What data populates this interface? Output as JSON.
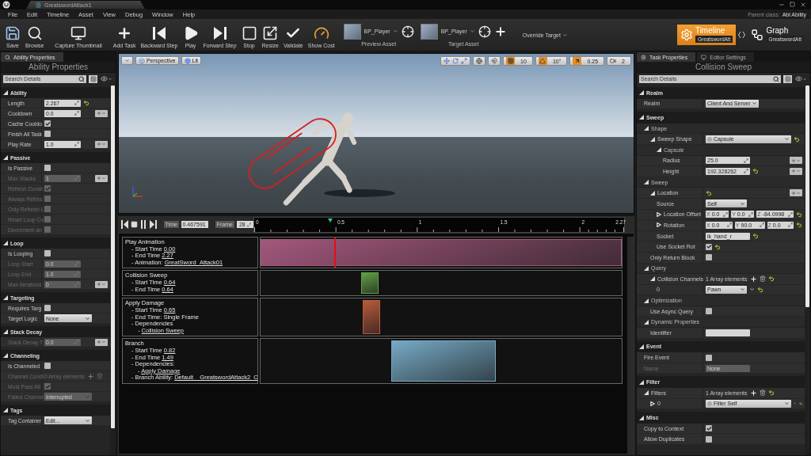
{
  "title_bar": {
    "tab": "GreatswordAttack1"
  },
  "menu": [
    "File",
    "Edit",
    "Timeline",
    "Asset",
    "View",
    "Debug",
    "Window",
    "Help"
  ],
  "parent_class": {
    "label": "Parent class:",
    "value": "Abl Ability"
  },
  "toolbar": {
    "buttons": [
      {
        "kind": "save",
        "label": "Save"
      },
      {
        "kind": "browse",
        "label": "Browse"
      },
      {
        "kind": "capture",
        "label": "Capture Thumbnail"
      },
      {
        "kind": "add",
        "label": "Add Task"
      },
      {
        "kind": "back",
        "label": "Backward Step"
      },
      {
        "kind": "play",
        "label": "Play"
      },
      {
        "kind": "forward",
        "label": "Forward Step"
      },
      {
        "kind": "stop",
        "label": "Stop"
      },
      {
        "kind": "resize",
        "label": "Resize"
      },
      {
        "kind": "validate",
        "label": "Validate"
      },
      {
        "kind": "cost",
        "label": "Show Cost"
      }
    ],
    "assets": [
      {
        "value": "BP_Player",
        "caption": "Preview Asset"
      },
      {
        "value": "BP_Player",
        "caption": "Target Asset"
      }
    ],
    "override": "Override Target",
    "modes": [
      {
        "label": "Timeline",
        "asset": "GreatswordAtt",
        "selected": true
      },
      {
        "label": "Graph",
        "asset": "GreatswordAtt",
        "selected": false
      }
    ]
  },
  "left_panel": {
    "tabs": [
      {
        "label": "Ability Properties",
        "selected": true
      }
    ],
    "title": "Ability Properties",
    "search": {
      "placeholder": "Search Details"
    },
    "categories": [
      {
        "kind": "category",
        "label": "Ability",
        "children": [
          {
            "kind": "number",
            "label": "Length",
            "value": "2.267",
            "reset": true
          },
          {
            "kind": "number",
            "label": "Cooldown",
            "value": "0.0",
            "spin": true
          },
          {
            "kind": "check",
            "label": "Cache Cooldo",
            "checked": true
          },
          {
            "kind": "check",
            "label": "Finish All Task",
            "checked": false
          },
          {
            "kind": "number",
            "label": "Play Rate",
            "value": "1.0",
            "spin": true
          }
        ]
      },
      {
        "kind": "category",
        "label": "Passive",
        "children": [
          {
            "kind": "check",
            "label": "Is Passive",
            "checked": false,
            "disabled": false
          },
          {
            "kind": "number",
            "label": "Max Stacks",
            "value": "1",
            "spin": true,
            "disabled": true
          },
          {
            "kind": "check",
            "label": "Refresh Durati",
            "checked": true,
            "disabled": true
          },
          {
            "kind": "check",
            "label": "Always Refres",
            "checked": false,
            "disabled": true
          },
          {
            "kind": "check",
            "label": "Only Refresh L",
            "checked": false,
            "disabled": true
          },
          {
            "kind": "check",
            "label": "Reset Loop Co",
            "checked": false,
            "disabled": true
          },
          {
            "kind": "check",
            "label": "Decrement an",
            "checked": false,
            "disabled": true
          }
        ]
      },
      {
        "kind": "category",
        "label": "Loop",
        "children": [
          {
            "kind": "check",
            "label": "Is Looping",
            "checked": false,
            "disabled": false
          },
          {
            "kind": "number",
            "label": "Loop Start",
            "value": "0.0",
            "disabled": true
          },
          {
            "kind": "number",
            "label": "Loop End",
            "value": "1.0",
            "disabled": true
          },
          {
            "kind": "number",
            "label": "Max Iterations",
            "value": "0",
            "spin": true,
            "disabled": true
          }
        ]
      },
      {
        "kind": "category",
        "label": "Targeting",
        "children": [
          {
            "kind": "check",
            "label": "Requires Targ",
            "checked": false
          },
          {
            "kind": "select",
            "label": "Target Logic",
            "value": "None"
          }
        ]
      },
      {
        "kind": "category",
        "label": "Stack Decay",
        "children": [
          {
            "kind": "number",
            "label": "Stack Decay T",
            "value": "0.0",
            "spin": true,
            "disabled": true
          }
        ]
      },
      {
        "kind": "category",
        "label": "Channeling",
        "children": [
          {
            "kind": "check",
            "label": "Is Channeled",
            "checked": false,
            "disabled": false
          },
          {
            "kind": "array",
            "label": "Channel Condi",
            "value": "0 Array elements",
            "disabled": true
          },
          {
            "kind": "check",
            "label": "Must Pass All",
            "checked": true,
            "disabled": true
          },
          {
            "kind": "select",
            "label": "Failed Channel",
            "value": "Interrupted",
            "disabled": true
          }
        ]
      },
      {
        "kind": "category",
        "label": "Tags",
        "children": [
          {
            "kind": "select",
            "label": "Tag Container",
            "value": "Edit..."
          }
        ]
      }
    ]
  },
  "viewport": {
    "view_buttons": [
      {
        "kind": "perspective",
        "label": "Perspective"
      },
      {
        "kind": "lit",
        "label": "Lit"
      }
    ],
    "snaps": [
      {
        "kind": "grid",
        "on": true,
        "value": "10"
      },
      {
        "kind": "angle",
        "on": true,
        "value": "10°"
      },
      {
        "kind": "scale",
        "on": true,
        "value": "0.25"
      }
    ],
    "camera_speed": "2"
  },
  "timeline": {
    "time": {
      "label": "Time",
      "value": "0.467591"
    },
    "frame": {
      "label": "Frame",
      "value": "28"
    },
    "playhead": {
      "level": 0.206
    },
    "ruler": [
      {
        "label": "0",
        "level": 0
      },
      {
        "label": "0.5",
        "level": 0.2203
      },
      {
        "label": "1",
        "level": 0.4405
      },
      {
        "label": "1.5",
        "level": 0.6608
      },
      {
        "label": "2",
        "level": 0.8811
      },
      {
        "label": "2.27",
        "level": 1
      }
    ],
    "tracks": [
      {
        "title": "Play Animation",
        "color": "#a3577c",
        "bar": {
          "start": {
            "level": 0
          },
          "end": {
            "level": 1
          }
        },
        "lines": [
          {
            "label": "- Start Time",
            "value": "0.00"
          },
          {
            "label": "- End Time",
            "value": "2.27"
          },
          {
            "label": "- Animation:",
            "value": "GreatSword_Attack01"
          }
        ]
      },
      {
        "title": "Collision Sweep",
        "color": "#62a046",
        "bar": {
          "start": {
            "level": 0.2775
          },
          "end": {
            "level": 0.326
          }
        },
        "lines": [
          {
            "label": "- Start Time",
            "value": "0.64"
          },
          {
            "label": "- End Time",
            "value": "0.64"
          }
        ]
      },
      {
        "title": "Apply Damage",
        "color": "#b85a3c",
        "bar": {
          "start": {
            "level": 0.2819
          },
          "end": {
            "level": 0.3304
          }
        },
        "lines": [
          {
            "label": "- Start Time",
            "value": "0.65"
          },
          {
            "label": "- End Time: Single Frame"
          },
          {
            "label": "- Dependencies",
            "children": [
              {
                "label": "-",
                "value": "Collision Sweep"
              }
            ]
          }
        ]
      },
      {
        "title": "Branch",
        "color": "#76aac6",
        "bar": {
          "start": {
            "level": 0.3612
          },
          "end": {
            "level": 0.6519
          }
        },
        "lines": [
          {
            "label": "- Start Time",
            "value": "0.82"
          },
          {
            "label": "- End Time",
            "value": "1.49"
          },
          {
            "label": "- Dependencies:",
            "children": [
              {
                "label": "-",
                "value": "Apply Damage"
              }
            ]
          },
          {
            "label": "- Branch Ability:",
            "value": "Default__GreatswordAttack2_C"
          }
        ]
      }
    ]
  },
  "right_panel": {
    "tabs": [
      {
        "label": "Task Properties",
        "selected": true
      },
      {
        "label": "Editor Settings",
        "selected": false
      }
    ],
    "title": "Collision Sweep",
    "search": {
      "placeholder": "Search Details"
    },
    "categories": [
      {
        "kind": "category",
        "label": "Realm",
        "children": [
          {
            "kind": "select",
            "label": "Realm",
            "value": "Client And Server"
          }
        ]
      },
      {
        "kind": "category",
        "label": "Sweep",
        "children": [
          {
            "kind": "group",
            "label": "Shape",
            "children": [
              {
                "kind": "class",
                "label": "Sweep Shape",
                "value": "Capsule",
                "reset": true,
                "expanded": true,
                "children": [
                  {
                    "kind": "group",
                    "label": "Capsule",
                    "children": [
                      {
                        "kind": "number",
                        "label": "Radius",
                        "value": "25.0",
                        "spin": true
                      },
                      {
                        "kind": "number",
                        "label": "Height",
                        "value": "192.328262",
                        "reset": true,
                        "spin": true
                      }
                    ]
                  }
                ]
              }
            ]
          },
          {
            "kind": "group",
            "label": "Sweep",
            "children": [
              {
                "kind": "none",
                "label": "Location",
                "reset": true,
                "spin": true,
                "expanded": true,
                "children": [
                  {
                    "kind": "select",
                    "label": "Source",
                    "value": "Self"
                  },
                  {
                    "kind": "vector",
                    "label": "Location Offset",
                    "expanded": false,
                    "reset": true,
                    "fields": [
                      {
                        "axis": "X",
                        "value": "0.0"
                      },
                      {
                        "axis": "Y",
                        "value": "0.0"
                      },
                      {
                        "axis": "Z",
                        "value": "-84.0998"
                      }
                    ]
                  },
                  {
                    "kind": "vector",
                    "label": "Rotation",
                    "expanded": false,
                    "reset": true,
                    "fields": [
                      {
                        "axis": "X",
                        "value": "0.0"
                      },
                      {
                        "axis": "Y",
                        "value": "90.0"
                      },
                      {
                        "axis": "Z",
                        "value": "0.0"
                      }
                    ]
                  },
                  {
                    "kind": "text",
                    "label": "Socket",
                    "value": "ik_hand_r",
                    "reset": true
                  },
                  {
                    "kind": "check",
                    "label": "Use Socket Rot",
                    "checked": true,
                    "reset": true
                  }
                ]
              },
              {
                "kind": "check",
                "label": "Only Return Block",
                "checked": false
              }
            ]
          },
          {
            "kind": "group",
            "label": "Query",
            "children": [
              {
                "kind": "array",
                "label": "Collision Channels",
                "value": "1 Array elements",
                "reset": true,
                "expanded": true,
                "children": [
                  {
                    "kind": "select",
                    "label": "0",
                    "value": "Pawn",
                    "element_menu": true,
                    "reset": true
                  }
                ]
              }
            ]
          },
          {
            "kind": "group",
            "label": "Optimization",
            "children": [
              {
                "kind": "check",
                "label": "Use Async Query",
                "checked": false
              }
            ]
          },
          {
            "kind": "group",
            "label": "Dynamic Properties",
            "children": [
              {
                "kind": "text",
                "label": "Identifier"
              }
            ]
          }
        ]
      },
      {
        "kind": "category",
        "label": "Event",
        "children": [
          {
            "kind": "check",
            "label": "Fire Event",
            "checked": false,
            "disabled": false
          },
          {
            "kind": "text",
            "label": "Name",
            "value": "None",
            "disabled": true
          }
        ]
      },
      {
        "kind": "category",
        "label": "Filter",
        "children": [
          {
            "kind": "array",
            "label": "Filters",
            "value": "1 Array elements",
            "reset": true,
            "expanded": true,
            "children": [
              {
                "kind": "class",
                "label": "0",
                "value": "Filter Self",
                "expanded": false,
                "element_menu": true,
                "reset": true
              }
            ]
          }
        ]
      },
      {
        "kind": "category",
        "label": "Misc",
        "children": [
          {
            "kind": "check",
            "label": "Copy to Context",
            "checked": true
          },
          {
            "kind": "check",
            "label": "Allow Duplicates",
            "checked": false
          }
        ]
      }
    ]
  }
}
